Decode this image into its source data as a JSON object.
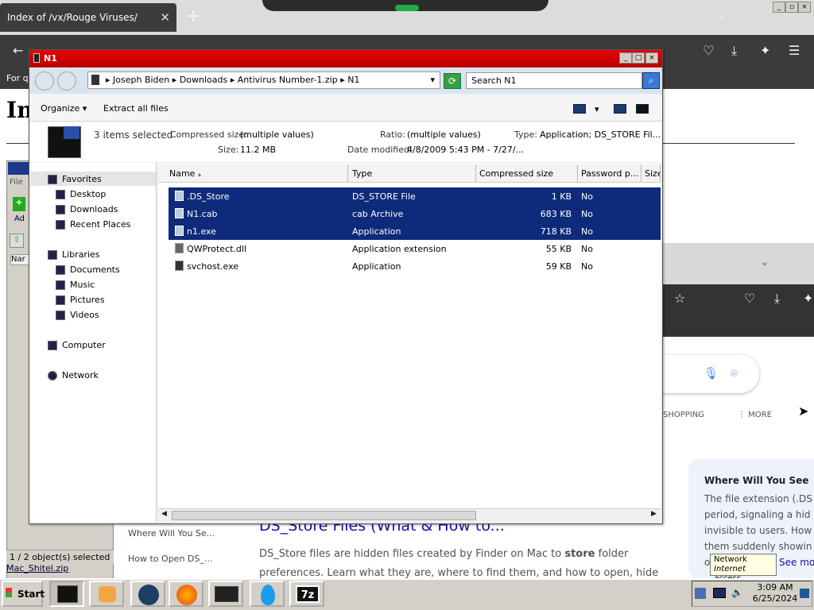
{
  "browser": {
    "tab_title": "Index of /vx/Rouge Viruses/",
    "tab_close": "✕",
    "new_tab": "+",
    "chevron": "⌄",
    "bookmarks_text": "For q",
    "page_heading": "In"
  },
  "browser2": {
    "tabs": [
      "SHOPPING",
      "⋮ MORE"
    ],
    "snippet_title": "Where Will You See",
    "snippet_lines": [
      "The file extension (.DS",
      "period, signaling a hid",
      "invisible to users. How",
      "them suddenly showin",
      "o"
    ],
    "see_more": "See mo",
    "tooltip_title": "Network",
    "tooltip_sub": "Internet access"
  },
  "results": {
    "side_items": [
      "Where Will You Se...",
      "How to Open DS_..."
    ],
    "title": "DS_Store Files (What & How to...",
    "snippet1_pre": "DS_Store files are hidden files created by Finder on Mac to ",
    "snippet1_bold": "store",
    "snippet1_post": " folder",
    "snippet2": "preferences. Learn what they are, where to find them, and how to open, hide"
  },
  "zip": {
    "sub_text": "File",
    "col": "Nar",
    "add": "Ad",
    "status": "1 / 2 object(s) selected",
    "path": "Mac_Shitel.zip"
  },
  "explorer": {
    "title": "N1",
    "breadcrumb": [
      "Joseph Biden",
      "Downloads",
      "Antivirus Number-1.zip",
      "N1"
    ],
    "search_placeholder": "Search N1",
    "organize": "Organize",
    "extract": "Extract all files",
    "details": {
      "selected": "3 items selected",
      "compressed_label": "Compressed size:",
      "compressed_value": "(multiple values)",
      "size_label": "Size:",
      "size_value": "11.2 MB",
      "ratio_label": "Ratio:",
      "ratio_value": "(multiple values)",
      "date_label": "Date modified:",
      "date_value": "4/8/2009 5:43 PM - 7/27/...",
      "type_label": "Type:",
      "type_value": "Application; DS_STORE Fil..."
    },
    "nav": {
      "favorites": "Favorites",
      "desktop": "Desktop",
      "downloads": "Downloads",
      "recent": "Recent Places",
      "libraries": "Libraries",
      "documents": "Documents",
      "music": "Music",
      "pictures": "Pictures",
      "videos": "Videos",
      "computer": "Computer",
      "network": "Network"
    },
    "columns": [
      "Name",
      "Type",
      "Compressed size",
      "Password p...",
      "Size"
    ],
    "files": [
      {
        "name": ".DS_Store",
        "type": "DS_STORE File",
        "size": "1 KB",
        "password": "No"
      },
      {
        "name": "N1.cab",
        "type": "cab Archive",
        "size": "683 KB",
        "password": "No"
      },
      {
        "name": "n1.exe",
        "type": "Application",
        "size": "718 KB",
        "password": "No"
      },
      {
        "name": "QWProtect.dll",
        "type": "Application extension",
        "size": "55 KB",
        "password": "No"
      },
      {
        "name": "svchost.exe",
        "type": "Application",
        "size": "59 KB",
        "password": "No"
      }
    ]
  },
  "taskbar": {
    "start": "Start",
    "time": "3:09 AM",
    "date": "6/25/2024",
    "zip_label": "7z"
  },
  "colors": {
    "title_red": "#d00000",
    "selection": "#0e2a7a"
  }
}
